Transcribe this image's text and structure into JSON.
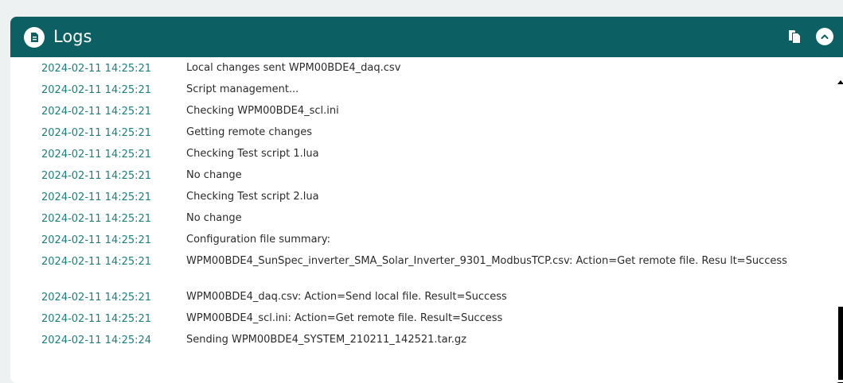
{
  "header": {
    "title": "Logs",
    "logo_icon": "logs-app-icon",
    "copy_icon": "copy-icon",
    "collapse_icon": "chevron-up-icon",
    "bg_color": "#0c5f62"
  },
  "logs": [
    {
      "time": "2024-02-11 14:25:21",
      "message": "Local changes sent WPM00BDE4_daq.csv"
    },
    {
      "time": "2024-02-11 14:25:21",
      "message": "Script management..."
    },
    {
      "time": "2024-02-11 14:25:21",
      "message": "Checking WPM00BDE4_scl.ini"
    },
    {
      "time": "2024-02-11 14:25:21",
      "message": "Getting remote changes"
    },
    {
      "time": "2024-02-11 14:25:21",
      "message": "Checking Test script 1.lua"
    },
    {
      "time": "2024-02-11 14:25:21",
      "message": "No change"
    },
    {
      "time": "2024-02-11 14:25:21",
      "message": "Checking Test script 2.lua"
    },
    {
      "time": "2024-02-11 14:25:21",
      "message": "No change"
    },
    {
      "time": "2024-02-11 14:25:21",
      "message": "Configuration file summary:"
    },
    {
      "time": "2024-02-11 14:25:21",
      "message": "WPM00BDE4_SunSpec_inverter_SMA_Solar_Inverter_9301_ModbusTCP.csv: Action=Get remote file. Resu lt=Success"
    },
    {
      "time": "2024-02-11 14:25:21",
      "message": "WPM00BDE4_daq.csv: Action=Send local file. Result=Success"
    },
    {
      "time": "2024-02-11 14:25:21",
      "message": "WPM00BDE4_scl.ini: Action=Get remote file. Result=Success"
    },
    {
      "time": "2024-02-11 14:25:24",
      "message": "Sending WPM00BDE4_SYSTEM_210211_142521.tar.gz"
    }
  ]
}
